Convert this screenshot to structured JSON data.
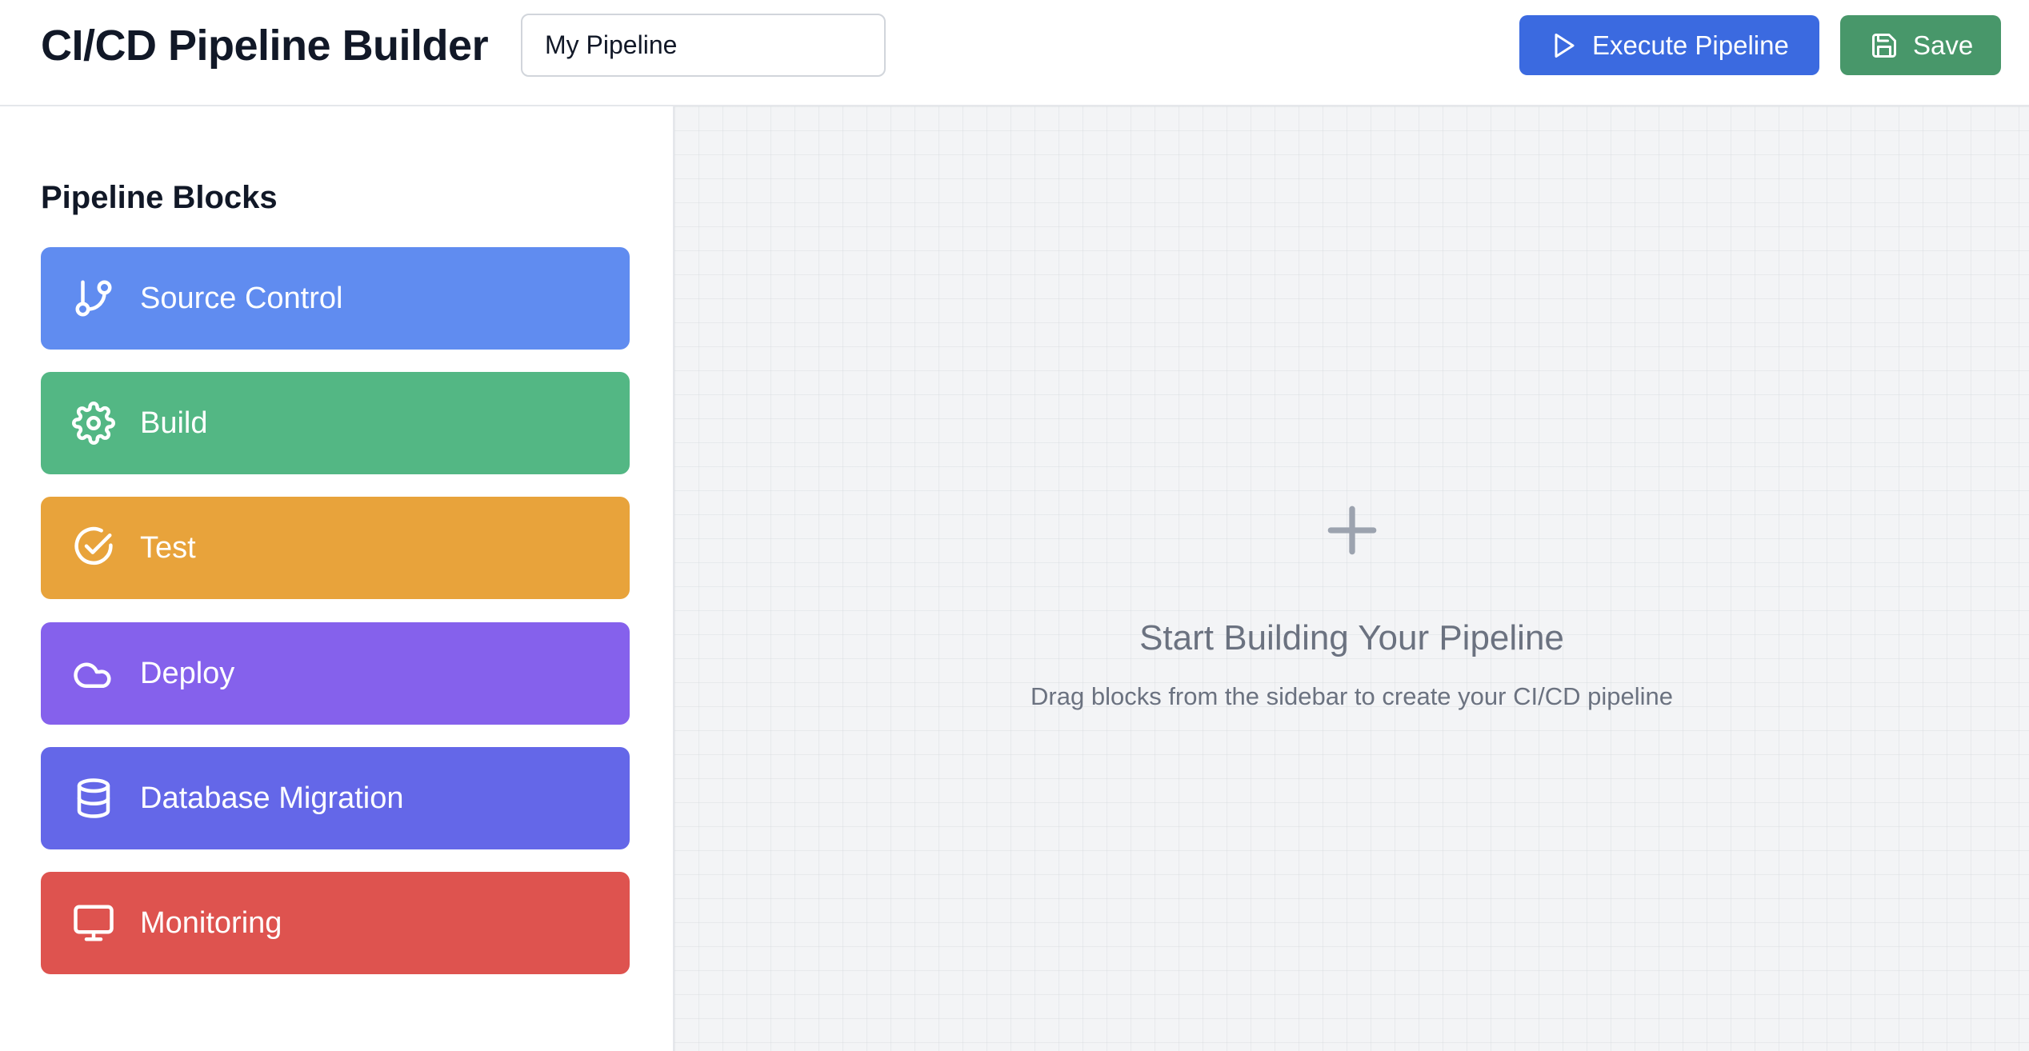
{
  "header": {
    "title": "CI/CD Pipeline Builder",
    "pipeline_name": "My Pipeline",
    "execute_label": "Execute Pipeline",
    "save_label": "Save"
  },
  "sidebar": {
    "title": "Pipeline Blocks",
    "blocks": [
      {
        "label": "Source Control",
        "icon": "git-branch-icon",
        "color": "#608cf0"
      },
      {
        "label": "Build",
        "icon": "gear-icon",
        "color": "#53b784"
      },
      {
        "label": "Test",
        "icon": "check-circle-icon",
        "color": "#e8a33b"
      },
      {
        "label": "Deploy",
        "icon": "cloud-icon",
        "color": "#8561ec"
      },
      {
        "label": "Database Migration",
        "icon": "database-icon",
        "color": "#6467e8"
      },
      {
        "label": "Monitoring",
        "icon": "monitor-icon",
        "color": "#de534f"
      }
    ]
  },
  "canvas": {
    "empty_title": "Start Building Your Pipeline",
    "empty_subtitle": "Drag blocks from the sidebar to create your CI/CD pipeline"
  },
  "colors": {
    "execute_button": "#3b6ae0",
    "save_button": "#48976a",
    "canvas_background": "#f3f4f6"
  }
}
